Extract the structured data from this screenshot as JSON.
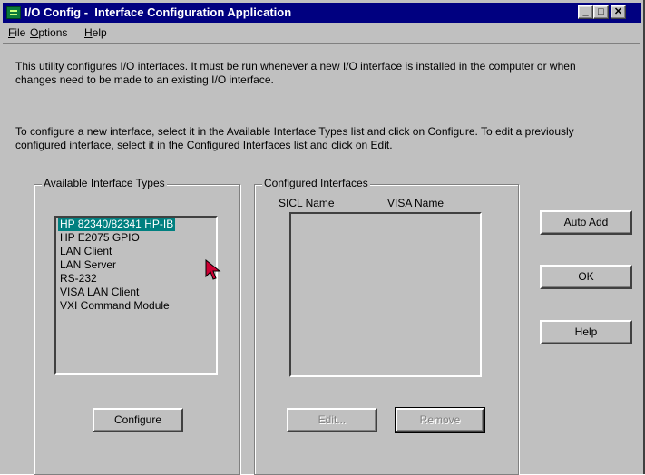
{
  "window": {
    "title": "I/O Config -  Interface Configuration Application",
    "controls": {
      "minimize": "_",
      "maximize": "□",
      "close": "✕"
    }
  },
  "menu": {
    "file": {
      "accel": "F",
      "rest": "ile"
    },
    "options": {
      "accel": "O",
      "rest": "ptions"
    },
    "help": {
      "accel": "H",
      "rest": "elp"
    }
  },
  "intro": {
    "para1": "This utility configures I/O interfaces.  It must be run whenever a new I/O interface is installed in the computer or when changes need to be made to an existing I/O interface.",
    "para2": "To configure a new interface, select it in the Available Interface Types list and click on Configure.  To edit a previously configured interface, select it in the Configured Interfaces list and click on Edit."
  },
  "available": {
    "label": "Available Interface Types",
    "items": [
      "HP 82340/82341 HP-IB",
      "HP E2075 GPIO",
      "LAN Client",
      "LAN Server",
      "RS-232",
      "VISA LAN Client",
      "VXI Command Module"
    ],
    "selected_index": 0,
    "configure_label": "Configure"
  },
  "configured": {
    "label": "Configured Interfaces",
    "col_sicl": "SICL Name",
    "col_visa": "VISA Name",
    "edit_label": "Edit...",
    "remove_label": "Remove"
  },
  "side_buttons": {
    "auto_add": "Auto Add",
    "ok": "OK",
    "help": "Help"
  },
  "colors": {
    "titlebar": "#000080",
    "selection": "#008080",
    "face": "#c0c0c0",
    "cursor": "#cc0033"
  }
}
